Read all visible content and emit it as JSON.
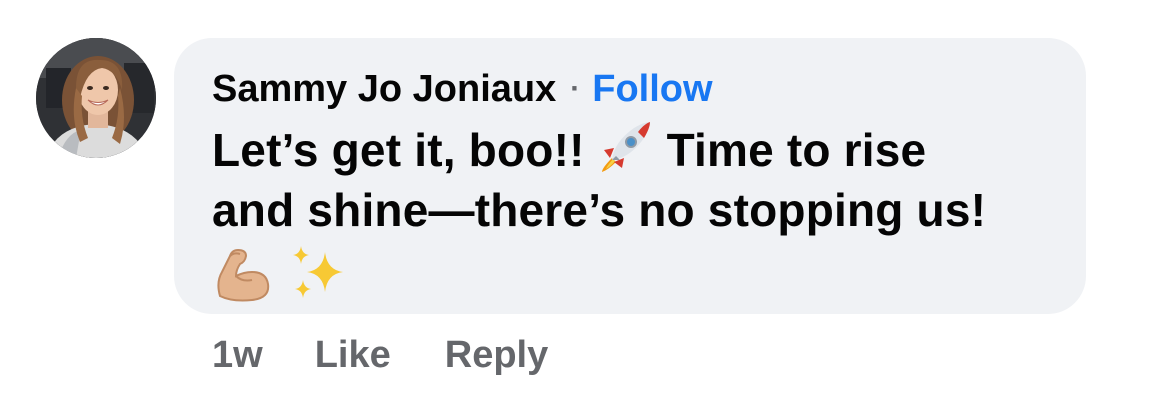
{
  "comment": {
    "author": {
      "name": "Sammy Jo Joniaux",
      "avatar": "profile-photo"
    },
    "separator": "·",
    "follow_label": "Follow",
    "text_lines": [
      {
        "before": "Let’s get it, boo!! ",
        "emoji": "rocket-emoji",
        "after": " Time to rise"
      },
      {
        "text": "and shine—there’s no stopping us!"
      }
    ],
    "trailing_emojis": [
      "flexed-biceps-emoji",
      "sparkles-emoji"
    ],
    "timestamp": "1w",
    "like_label": "Like",
    "reply_label": "Reply"
  },
  "colors": {
    "bubble_bg": "#f0f2f5",
    "name_text": "#050505",
    "follow_link": "#1877f2",
    "meta_text": "#65676b"
  }
}
